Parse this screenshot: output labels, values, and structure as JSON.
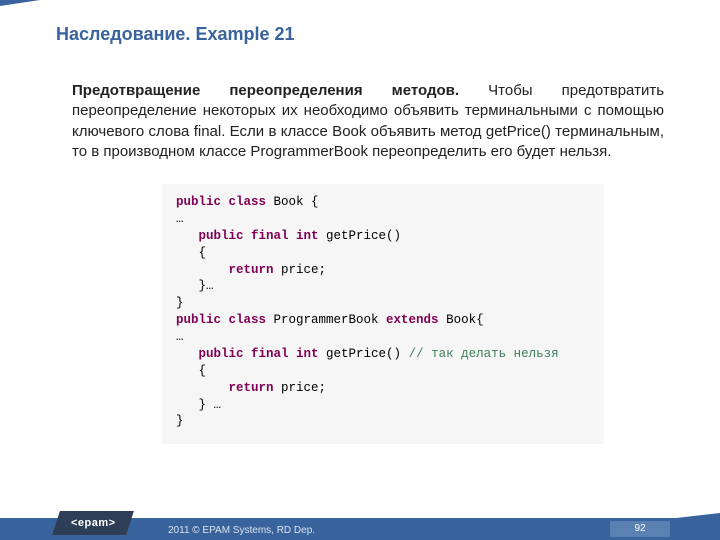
{
  "title": "Наследование. Example 21",
  "para_strong": "Предотвращение переопределения методов.",
  "para_rest": " Чтобы предотвратить переопределение некоторых их необходимо объявить терминальными с помощью ключевого слова final. Если в классе Book объявить метод getPrice() терминальным, то в производном классе ProgrammerBook переопределить его будет нельзя.",
  "code": {
    "l1_kw": "public class",
    "l1_rest": " Book {",
    "l2": "…",
    "l3_kw": "public final int",
    "l3_rest": " getPrice()",
    "l4": "{",
    "l5_kw": "return",
    "l5_rest": " price;",
    "l6": "}…",
    "l7": "}",
    "l8_kw1": "public class",
    "l8_mid": " ProgrammerBook ",
    "l8_kw2": "extends",
    "l8_rest": " Book{",
    "l9": "…",
    "l10_kw": "public final int",
    "l10_rest": " getPrice() ",
    "l10_cm": "// так делать нельзя",
    "l11": "{",
    "l12_kw": "return",
    "l12_rest": " price;",
    "l13": "} …",
    "l14": "}"
  },
  "footer": {
    "logo": "<epam>",
    "copyright": "2011 © EPAM Systems, RD Dep.",
    "page": "92"
  }
}
